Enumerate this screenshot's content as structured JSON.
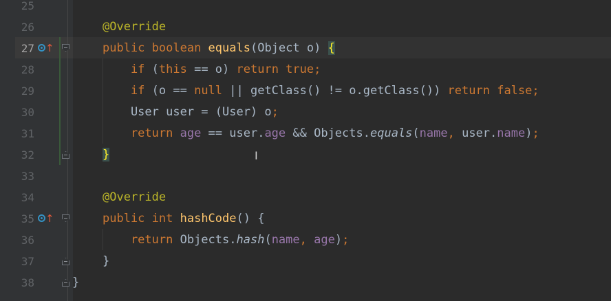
{
  "editor": {
    "lines": [
      {
        "number": "25",
        "parts": []
      },
      {
        "number": "26",
        "parts": [
          {
            "t": "@Override",
            "c": "annot"
          }
        ]
      },
      {
        "number": "27",
        "active": true,
        "impl": true,
        "fold": "open",
        "parts": [
          {
            "t": "public ",
            "c": "kw"
          },
          {
            "t": "boolean ",
            "c": "kw"
          },
          {
            "t": "equals",
            "c": "fn"
          },
          {
            "t": "(Object o) ",
            "c": "plain"
          },
          {
            "t": "{",
            "c": "brace-hl"
          }
        ]
      },
      {
        "number": "28",
        "parts": [
          {
            "t": "    if ",
            "c": "kw"
          },
          {
            "t": "(",
            "c": "plain"
          },
          {
            "t": "this",
            "c": "kw"
          },
          {
            "t": " == o) ",
            "c": "plain"
          },
          {
            "t": "return ",
            "c": "kw"
          },
          {
            "t": "true",
            "c": "kw"
          },
          {
            "t": ";",
            "c": "kw"
          }
        ]
      },
      {
        "number": "29",
        "parts": [
          {
            "t": "    if ",
            "c": "kw"
          },
          {
            "t": "(o == ",
            "c": "plain"
          },
          {
            "t": "null",
            "c": "kw"
          },
          {
            "t": " || getClass() != o.getClass()) ",
            "c": "plain"
          },
          {
            "t": "return ",
            "c": "kw"
          },
          {
            "t": "false",
            "c": "kw"
          },
          {
            "t": ";",
            "c": "kw"
          }
        ]
      },
      {
        "number": "30",
        "parts": [
          {
            "t": "    User user = (User) o",
            "c": "plain"
          },
          {
            "t": ";",
            "c": "kw"
          }
        ]
      },
      {
        "number": "31",
        "parts": [
          {
            "t": "    return ",
            "c": "kw"
          },
          {
            "t": "age",
            "c": "field"
          },
          {
            "t": " == user.",
            "c": "plain"
          },
          {
            "t": "age",
            "c": "field"
          },
          {
            "t": " && Objects.",
            "c": "plain"
          },
          {
            "t": "equals",
            "c": "italic"
          },
          {
            "t": "(",
            "c": "plain"
          },
          {
            "t": "name",
            "c": "field"
          },
          {
            "t": ", ",
            "c": "kw"
          },
          {
            "t": "user.",
            "c": "plain"
          },
          {
            "t": "name",
            "c": "field"
          },
          {
            "t": ")",
            "c": "plain"
          },
          {
            "t": ";",
            "c": "kw"
          }
        ]
      },
      {
        "number": "32",
        "fold": "close",
        "parts": [
          {
            "t": "}",
            "c": "brace-hl"
          }
        ]
      },
      {
        "number": "33",
        "parts": []
      },
      {
        "number": "34",
        "parts": [
          {
            "t": "@Override",
            "c": "annot"
          }
        ]
      },
      {
        "number": "35",
        "impl": true,
        "fold": "open",
        "parts": [
          {
            "t": "public ",
            "c": "kw"
          },
          {
            "t": "int ",
            "c": "kw"
          },
          {
            "t": "hashCode",
            "c": "fn"
          },
          {
            "t": "() {",
            "c": "plain"
          }
        ]
      },
      {
        "number": "36",
        "parts": [
          {
            "t": "    return ",
            "c": "kw"
          },
          {
            "t": "Objects.",
            "c": "plain"
          },
          {
            "t": "hash",
            "c": "italic"
          },
          {
            "t": "(",
            "c": "plain"
          },
          {
            "t": "name",
            "c": "field"
          },
          {
            "t": ", ",
            "c": "kw"
          },
          {
            "t": "age",
            "c": "field"
          },
          {
            "t": ")",
            "c": "plain"
          },
          {
            "t": ";",
            "c": "kw"
          }
        ]
      },
      {
        "number": "37",
        "fold": "close",
        "parts": [
          {
            "t": "}",
            "c": "plain"
          }
        ]
      },
      {
        "number": "38",
        "fold": "close",
        "outer": true,
        "parts": [
          {
            "t": "}",
            "c": "plain"
          }
        ]
      }
    ],
    "icons": {
      "implements": "implements-method-icon",
      "override_up": "override-arrow-icon",
      "fold_open": "fold-open-icon",
      "fold_close": "fold-close-icon",
      "cursor": "text-cursor-icon"
    },
    "colors": {
      "background": "#2b2b2b",
      "gutter": "#313335",
      "keyword": "#cc7832",
      "annotation": "#bbb529",
      "method": "#ffc66d",
      "field": "#9876aa",
      "text": "#a9b7c6",
      "line_number": "#606366"
    }
  }
}
